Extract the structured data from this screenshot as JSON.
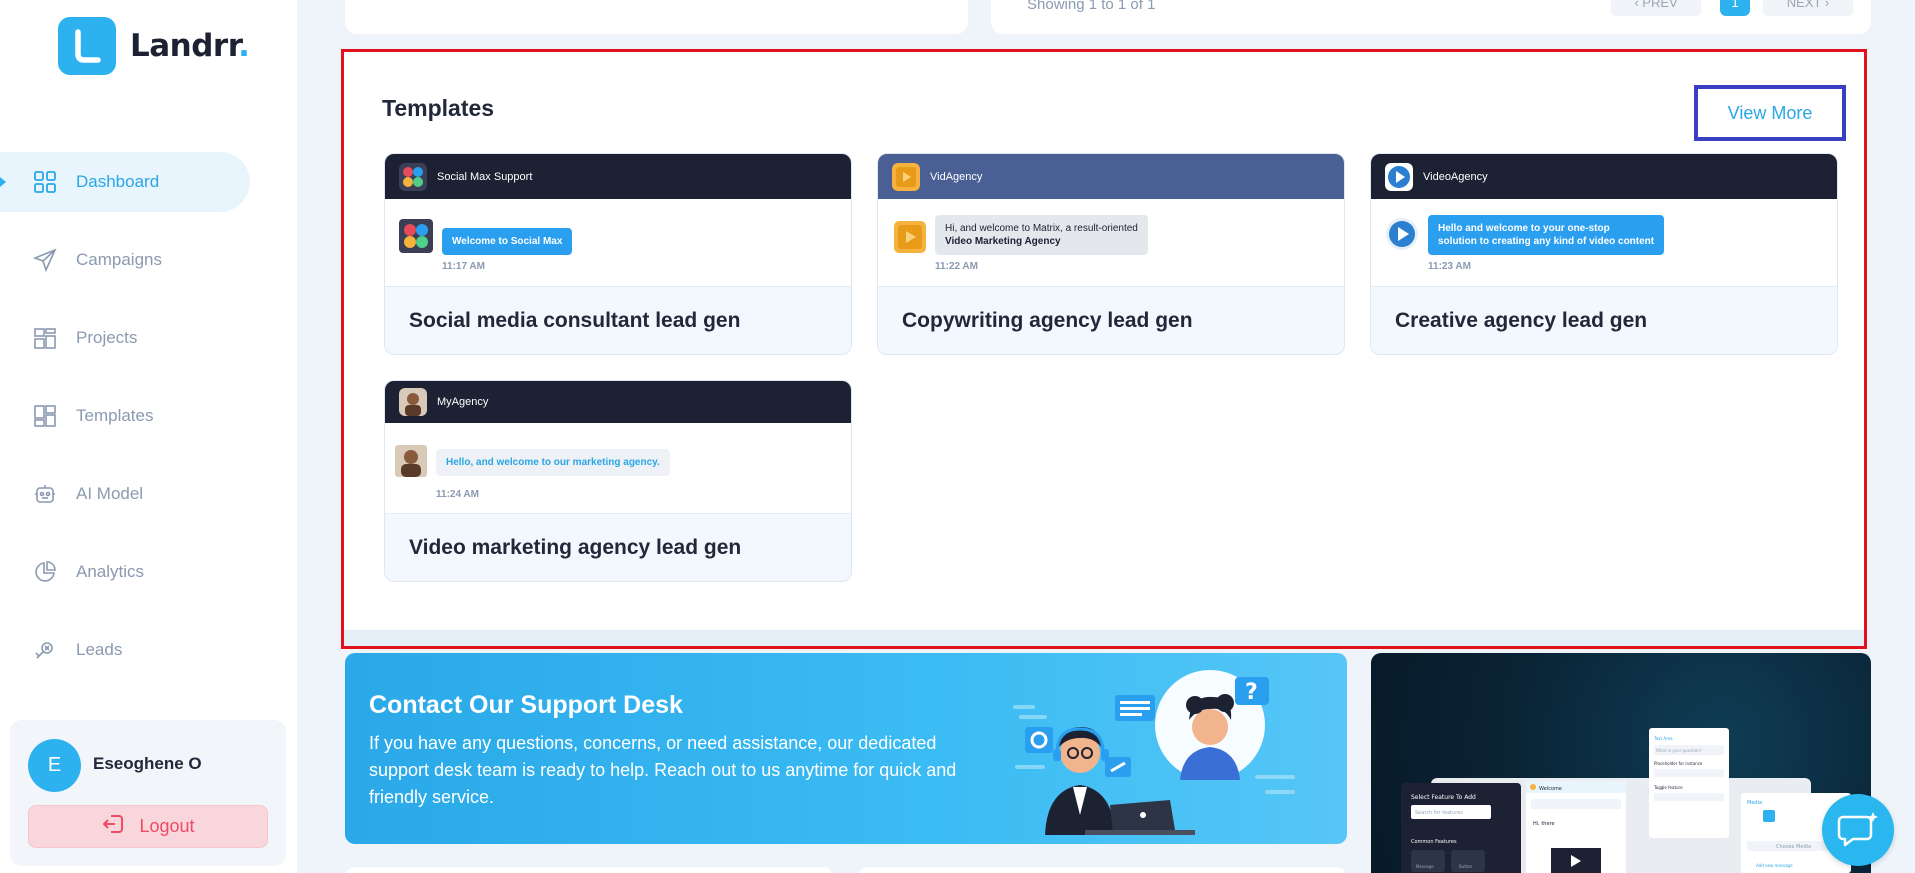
{
  "brand": {
    "name": "Landrr",
    "dot": ".",
    "accent": "#2db2ef"
  },
  "sidebar": {
    "items": [
      {
        "label": "Dashboard",
        "icon": "grid-icon",
        "active": true
      },
      {
        "label": "Campaigns",
        "icon": "paper-plane-icon",
        "active": false
      },
      {
        "label": "Projects",
        "icon": "projects-icon",
        "active": false
      },
      {
        "label": "Templates",
        "icon": "templates-icon",
        "active": false
      },
      {
        "label": "AI Model",
        "icon": "robot-icon",
        "active": false
      },
      {
        "label": "Analytics",
        "icon": "pie-chart-icon",
        "active": false
      },
      {
        "label": "Leads",
        "icon": "leads-icon",
        "active": false
      }
    ],
    "user": {
      "initial": "E",
      "name": "Eseoghene O"
    },
    "logout_label": "Logout"
  },
  "top_pagination": {
    "showing_text": "Showing 1 to 1 of 1",
    "prev_label": "‹ PREV",
    "page": "1",
    "next_label": "NEXT ›"
  },
  "templates": {
    "title": "Templates",
    "view_more_label": "View More",
    "cards": [
      {
        "title": "Social media consultant lead gen",
        "preview_name": "Social Max Support",
        "message_prefix": "Welcome to ",
        "message_bold": "Social Max",
        "time": "11:17 AM"
      },
      {
        "title": "Copywriting agency lead gen",
        "preview_name": "VidAgency",
        "message_line1": "Hi, and welcome to Matrix, a result-oriented",
        "message_line2": "Video Marketing Agency",
        "time": "11:22 AM"
      },
      {
        "title": "Creative agency lead gen",
        "preview_name": "VideoAgency",
        "message_line1": "Hello and welcome to your one-stop",
        "message_line2": "solution to creating any kind of video content",
        "time": "11:23 AM"
      },
      {
        "title": "Video marketing agency lead gen",
        "preview_name": "MyAgency",
        "message": "Hello, and welcome to our marketing agency.",
        "time": "11:24 AM"
      }
    ]
  },
  "support": {
    "title": "Contact Our Support Desk",
    "body": "If you have any questions, concerns, or need assistance, our dedicated support desk team is ready to help. Reach out to us anytime for quick and friendly service."
  },
  "promo": {
    "panel_title": "Select Feature To Add",
    "search_placeholder": "Search for features",
    "common_features": "Common Features",
    "message_label": "Message",
    "button_label": "Button",
    "welcome_tab": "Welcome",
    "hi_there": "Hi, there",
    "text_area_title": "Text Area",
    "question_placeholder": "What is your question?",
    "placeholder_label": "Placeholder for instance",
    "toggle_label": "Toggle feature",
    "media_title": "Media",
    "choose_media": "Choose Media",
    "add_media_link": "Add new message"
  },
  "colors": {
    "highlight_box": "#e0121b",
    "view_more_box": "#3a3fc2"
  }
}
